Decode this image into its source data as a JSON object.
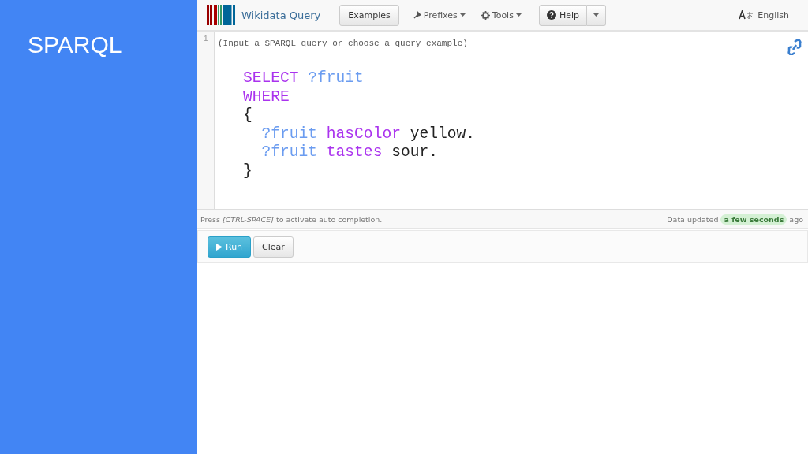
{
  "slide": {
    "title": "SPARQL"
  },
  "navbar": {
    "brand": "Wikidata Query",
    "items": [
      {
        "label": "Examples",
        "kind": "button"
      },
      {
        "label": "Prefixes",
        "kind": "menu"
      },
      {
        "label": "Tools",
        "kind": "menu"
      },
      {
        "label": "Help",
        "kind": "split"
      }
    ],
    "language": "English"
  },
  "editor": {
    "line_number": "1",
    "first_line": "(Input a SPARQL query or choose a query example)",
    "code": [
      [
        {
          "kind": "keyword",
          "text": "SELECT"
        },
        {
          "kind": "variable",
          "text": " ?fruit"
        }
      ],
      [
        {
          "kind": "keyword",
          "text": "WHERE"
        }
      ],
      [
        {
          "kind": "plain",
          "text": "{"
        }
      ],
      [
        {
          "kind": "variable",
          "text": "  ?fruit"
        },
        {
          "kind": "keyword",
          "text": " hasColor"
        },
        {
          "kind": "plain",
          "text": " yellow."
        }
      ],
      [
        {
          "kind": "variable",
          "text": "  ?fruit"
        },
        {
          "kind": "keyword",
          "text": " tastes"
        },
        {
          "kind": "plain",
          "text": " sour."
        }
      ],
      [
        {
          "kind": "plain",
          "text": "}"
        }
      ]
    ]
  },
  "status_bar": {
    "hint": "Press *[CTRL-SPACE]* to activate auto completion.",
    "updated_label": "Data updated",
    "updated_badge": "a few seconds",
    "updated_suffix": "ago"
  },
  "actions": [
    {
      "label": "Run",
      "kind": "primary"
    },
    {
      "label": "Clear",
      "kind": "default"
    }
  ]
}
